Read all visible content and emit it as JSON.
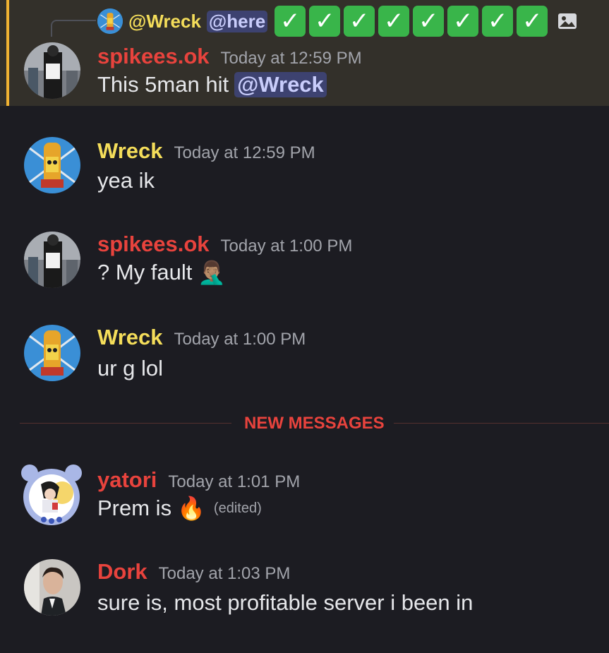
{
  "colors": {
    "background": "#1c1c22",
    "highlight": "#33302a",
    "highlight_bar": "#f0b232",
    "red_name": "#e8433d",
    "yellow_name": "#f4dd5a",
    "mention_bg": "#3d4270",
    "timestamp": "#a2a4ab",
    "text": "#e6e7ea"
  },
  "reply_preview": {
    "author": "@Wreck",
    "mention": "@here",
    "checkmark_count": 8,
    "checkmark_icon": "white-check-mark-emoji",
    "attachment_icon": "image-icon"
  },
  "messages": [
    {
      "author": "spikees.ok",
      "timestamp": "Today at 12:59 PM",
      "text": "This 5man hit ",
      "mention": "@Wreck",
      "highlighted": true
    },
    {
      "author": "Wreck",
      "timestamp": "Today at 12:59 PM",
      "text": "yea ik"
    },
    {
      "author": "spikees.ok",
      "timestamp": "Today at 1:00 PM",
      "text": "? My fault",
      "emoji": "🤦🏽‍♂️"
    },
    {
      "author": "Wreck",
      "timestamp": "Today at 1:00 PM",
      "text": "ur g lol"
    },
    {
      "author": "yatori",
      "timestamp": "Today at 1:01 PM",
      "text": "Prem is",
      "emoji": "🔥",
      "edited": "(edited)"
    },
    {
      "author": "Dork",
      "timestamp": "Today at 1:03 PM",
      "text": "sure is, most profitable server i been in"
    }
  ],
  "divider": {
    "label": "NEW MESSAGES"
  }
}
